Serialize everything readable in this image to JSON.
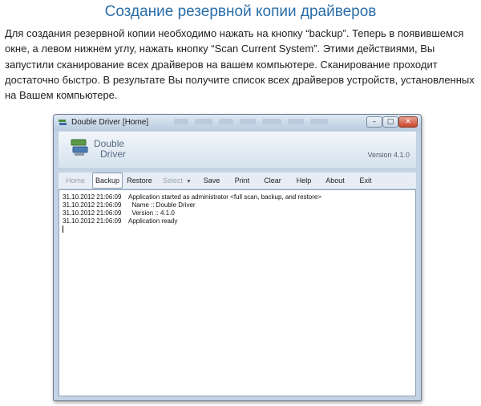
{
  "article": {
    "heading": "Создание резервной копии драйверов",
    "paragraph": "Для создания резервной копии необходимо нажать на кнопку “backup”. Теперь в появившемся окне, а левом нижнем углу, нажать кнопку “Scan Current System”.  Этими действиями, Вы запустили сканирование всех драйверов на вашем компьютере. Сканирование проходит достаточно быстро. В результате Вы получите список всех драйверов устройств, установленных на Вашем компьютере."
  },
  "window": {
    "title": "Double Driver [Home]",
    "controls": {
      "minimize": "–",
      "maximize": "□",
      "close": "✕"
    },
    "logo_line1": "Double",
    "logo_line2": "Driver",
    "version": "Version 4.1.0",
    "toolbar": {
      "home": "Home",
      "backup": "Backup",
      "restore": "Restore",
      "select": "Select",
      "save": "Save",
      "print": "Print",
      "clear": "Clear",
      "help": "Help",
      "about": "About",
      "exit": "Exit"
    },
    "log": [
      {
        "timestamp": "31.10.2012 21:06:09",
        "message": "Application started as administrator <full scan, backup, and restore>"
      },
      {
        "timestamp": "31.10.2012 21:06:09",
        "message": "  Name :: Double Driver"
      },
      {
        "timestamp": "31.10.2012 21:06:09",
        "message": "  Version :: 4.1.0"
      },
      {
        "timestamp": "31.10.2012 21:06:09",
        "message": "Application ready"
      }
    ]
  },
  "icons": {
    "app_icon": "double-driver-app-icon",
    "logo_icon": "double-driver-logo-icon",
    "select_dropdown": "chevron-down-icon"
  },
  "colors": {
    "heading": "#2a6ea8",
    "window_frame": "#c4d3e3",
    "close_button": "#c7442c"
  }
}
